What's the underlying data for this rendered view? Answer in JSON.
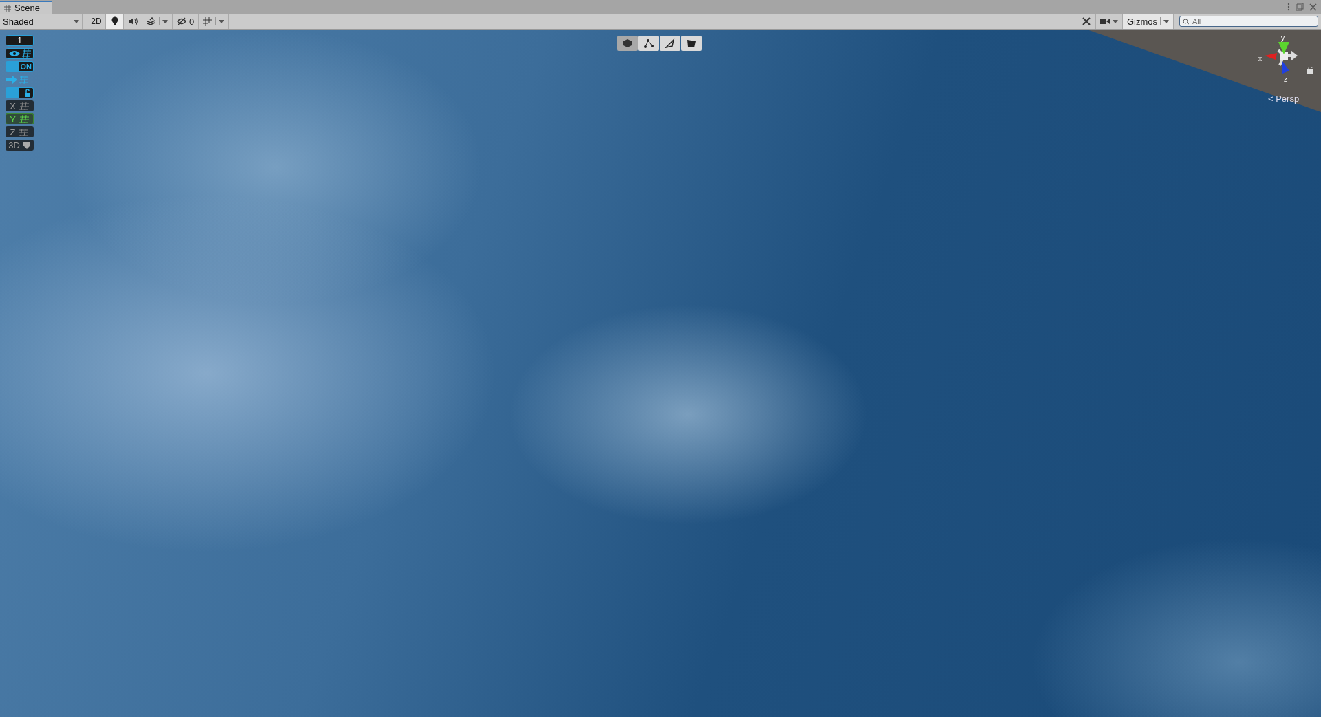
{
  "tab": {
    "label": "Scene",
    "selected": true
  },
  "toolbar": {
    "draw_mode": "Shaded",
    "mode_2d": {
      "label": "2D",
      "on": false
    },
    "lighting": {
      "on": true
    },
    "audio": {
      "on": false
    },
    "hidden_count": "0",
    "gizmos": {
      "label": "Gizmos"
    },
    "search": {
      "placeholder": "All"
    }
  },
  "left_tools": [
    {
      "kind": "number",
      "label": "1"
    },
    {
      "kind": "eye-grid",
      "on": true
    },
    {
      "kind": "toggle",
      "label": "ON",
      "on": true
    },
    {
      "kind": "arrow-grid",
      "on": true
    },
    {
      "kind": "lock",
      "on": true
    },
    {
      "kind": "axis",
      "label": "X",
      "selected": false
    },
    {
      "kind": "axis",
      "label": "Y",
      "selected": true
    },
    {
      "kind": "axis",
      "label": "Z",
      "selected": false
    },
    {
      "kind": "mode",
      "label": "3D"
    }
  ],
  "tools_overlay": [
    {
      "kind": "cube",
      "selected": true
    },
    {
      "kind": "nodes",
      "selected": false
    },
    {
      "kind": "pen",
      "selected": false
    },
    {
      "kind": "shape",
      "selected": false
    }
  ],
  "orientation_gizmo": {
    "x_label": "x",
    "y_label": "y",
    "z_label": "z",
    "projection": "< Persp"
  }
}
